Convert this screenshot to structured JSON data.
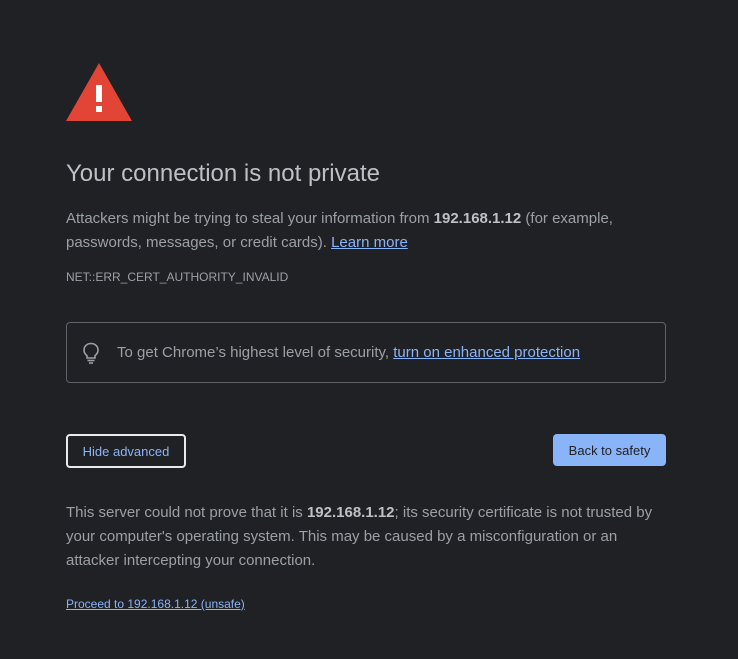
{
  "title": "Your connection is not private",
  "description": {
    "prefix": "Attackers might be trying to steal your information from ",
    "host": "192.168.1.12",
    "suffix": " (for example, passwords, messages, or credit cards). ",
    "learn_more": "Learn more"
  },
  "error_code": "NET::ERR_CERT_AUTHORITY_INVALID",
  "enhanced_protection": {
    "icon": "lightbulb-icon",
    "text": "To get Chrome’s highest level of security, ",
    "link": "turn on enhanced protection"
  },
  "buttons": {
    "hide_advanced": "Hide advanced",
    "back_to_safety": "Back to safety"
  },
  "details": {
    "prefix": "This server could not prove that it is ",
    "host": "192.168.1.12",
    "suffix": "; its security certificate is not trusted by your computer's operating system. This may be caused by a misconfiguration or an attacker intercepting your connection."
  },
  "proceed_link": "Proceed to 192.168.1.12 (unsafe)",
  "colors": {
    "background": "#202124",
    "warning_red": "#e24435",
    "link_blue": "#8ab4f8",
    "primary_button": "#8ab4f8"
  },
  "icons": {
    "warning": "warning-triangle-icon"
  }
}
